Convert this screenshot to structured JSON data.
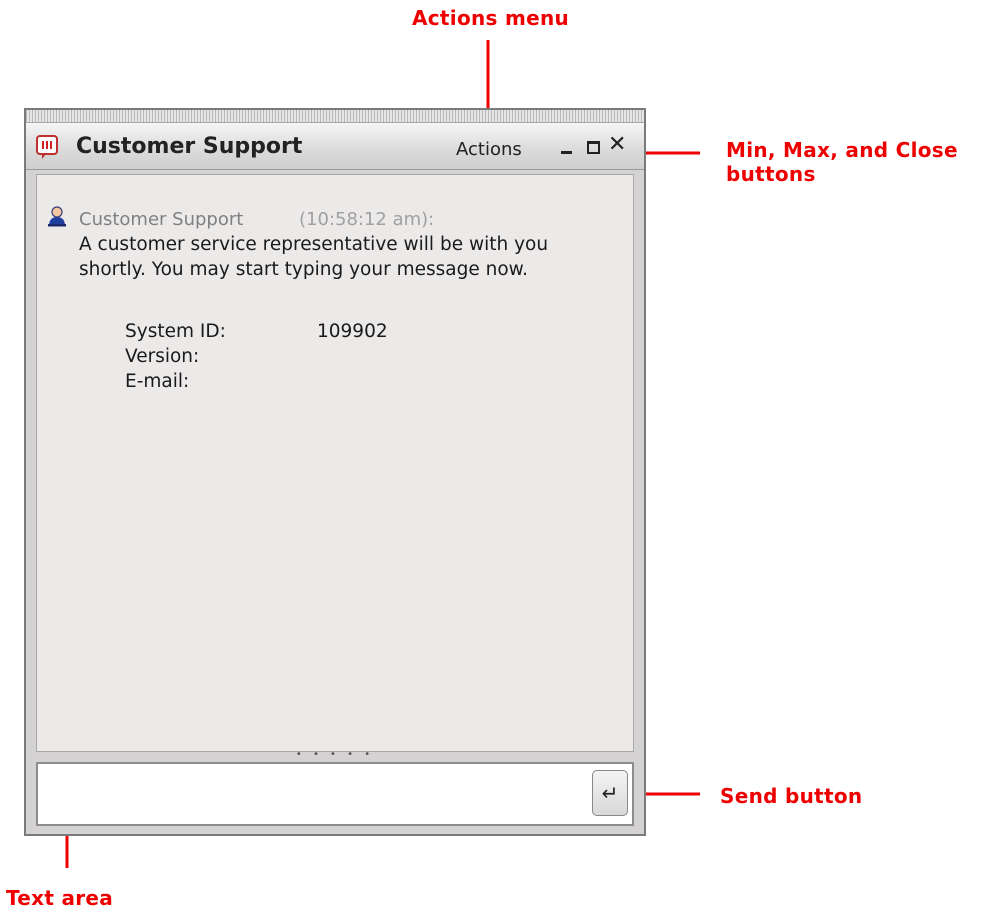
{
  "annotations": {
    "actions_menu": "Actions menu",
    "min_max_close_line1": "Min, Max, and Close",
    "min_max_close_line2": "buttons",
    "send_button": "Send button",
    "text_area": "Text area",
    "color": "#ee0000"
  },
  "window": {
    "title": "Customer Support",
    "actions_label": "Actions",
    "icons": {
      "app": "chat-bubble-icon",
      "minimize": "minimize-icon",
      "maximize": "maximize-icon",
      "close": "close-icon"
    }
  },
  "message": {
    "sender": "Customer Support",
    "time": "(10:58:12 am):",
    "body": "A customer service representative will be with you shortly. You may start typing your message now.",
    "info": [
      {
        "label": "System ID:",
        "value": "109902"
      },
      {
        "label": "Version:",
        "value": ""
      },
      {
        "label": "E-mail:",
        "value": ""
      }
    ],
    "icon": "user-icon"
  },
  "splitter": {
    "grip": "• • • • •"
  },
  "input": {
    "value": "",
    "send_glyph": "↵"
  }
}
